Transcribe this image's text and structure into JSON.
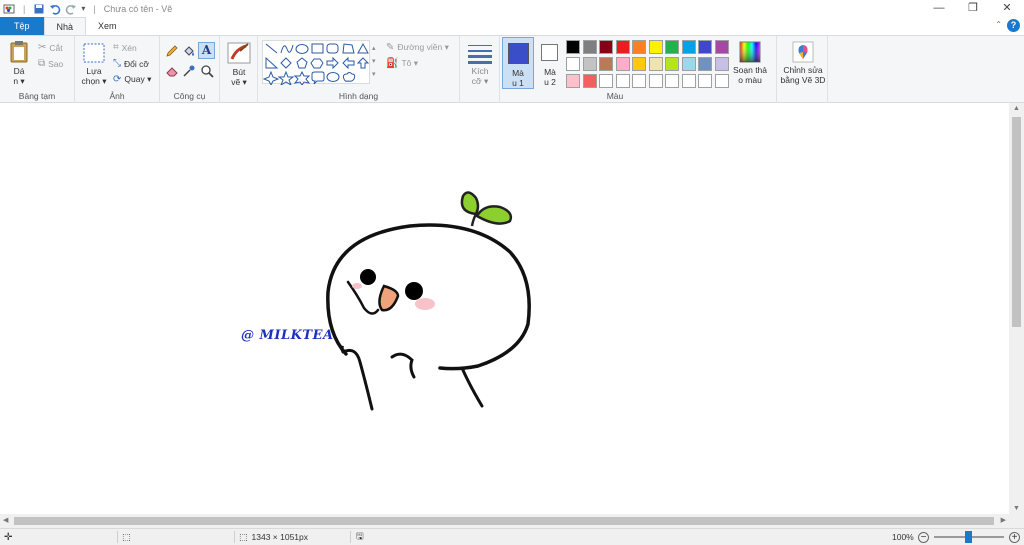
{
  "window": {
    "title": "Chưa có tên - Vẽ",
    "minimize": "—",
    "maximize": "❐",
    "close": "✕"
  },
  "tabs": [
    {
      "label": "Tệp"
    },
    {
      "label": "Nhà"
    },
    {
      "label": "Xem"
    }
  ],
  "ribbon": {
    "clipboard": {
      "group_label": "Bảng tạm",
      "paste_label_1": "Dá",
      "paste_label_2": "n ▾",
      "cut_label": "Cắt",
      "copy_label": "Sao"
    },
    "image": {
      "group_label": "Ảnh",
      "select_label_1": "Lựa",
      "select_label_2": "chọn ▾",
      "crop_label": "Xén",
      "resize_label": "Đổi cỡ",
      "rotate_label": "Quay ▾"
    },
    "tools": {
      "group_label": "Công cụ"
    },
    "brushes": {
      "label_1": "Bút",
      "label_2": "vẽ ▾"
    },
    "shapes": {
      "group_label": "Hình dạng",
      "outline_label": "Đường viền ▾",
      "fill_label": "Tô ▾"
    },
    "size": {
      "label_1": "Kích",
      "label_2": "cỡ ▾"
    },
    "colors": {
      "group_label": "Màu",
      "color1_label_1": "Mà",
      "color1_label_2": "u 1",
      "color2_label_1": "Mà",
      "color2_label_2": "u 2",
      "color1_value": "#3a4ec8",
      "color2_value": "#ffffff",
      "edit_colors_label_1": "Soạn thả",
      "edit_colors_label_2": "o màu",
      "paint3d_label_1": "Chỉnh sửa",
      "paint3d_label_2": "bằng Vẽ 3D",
      "palette_row1": [
        "#000000",
        "#7f7f7f",
        "#880015",
        "#ed1c24",
        "#ff7f27",
        "#fff200",
        "#22b14c",
        "#00a2e8",
        "#3f48cc",
        "#a349a4"
      ],
      "palette_row2": [
        "#ffffff",
        "#c3c3c3",
        "#b97a57",
        "#ffaec9",
        "#ffc90e",
        "#efe4b0",
        "#b5e61d",
        "#99d9ea",
        "#7092be",
        "#c8bfe7"
      ],
      "palette_row3": [
        "#ffc0cb",
        "#f06060",
        "#ffffff",
        "#ffffff",
        "#ffffff",
        "#ffffff",
        "#ffffff",
        "#ffffff",
        "#ffffff",
        "#ffffff"
      ]
    }
  },
  "canvas": {
    "watermark": "@ MILKTEA"
  },
  "status": {
    "canvas_size": "1343 × 1051px",
    "zoom": "100%",
    "zoom_level_percent": 100
  }
}
